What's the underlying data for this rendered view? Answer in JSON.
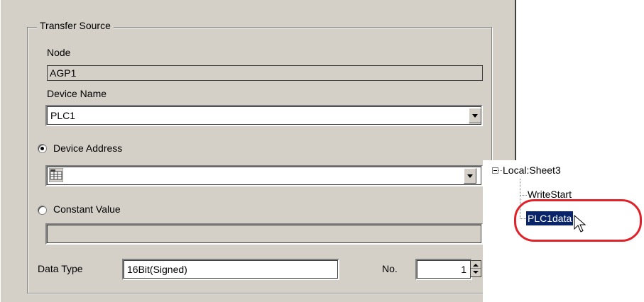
{
  "group": {
    "title": "Transfer Source"
  },
  "node": {
    "label": "Node",
    "value": "AGP1"
  },
  "device_name": {
    "label": "Device Name",
    "value": "PLC1"
  },
  "device_address": {
    "label": "Device Address",
    "selected": true,
    "value": ""
  },
  "constant_value": {
    "label": "Constant Value",
    "selected": false,
    "value": ""
  },
  "data_type": {
    "label": "Data Type",
    "value": "16Bit(Signed)"
  },
  "number": {
    "label": "No.",
    "value": "1"
  },
  "tree": {
    "root": "Local:Sheet3",
    "children": [
      {
        "label": "WriteStart",
        "selected": false
      },
      {
        "label": "PLC1data",
        "selected": true
      }
    ]
  },
  "colors": {
    "highlight_ring": "#e0222a",
    "selection": "#0a246a",
    "panel": "#d4d0c8"
  },
  "icons": {
    "address_input": "device-address-grid-icon",
    "cursor": "mouse-pointer-icon"
  }
}
